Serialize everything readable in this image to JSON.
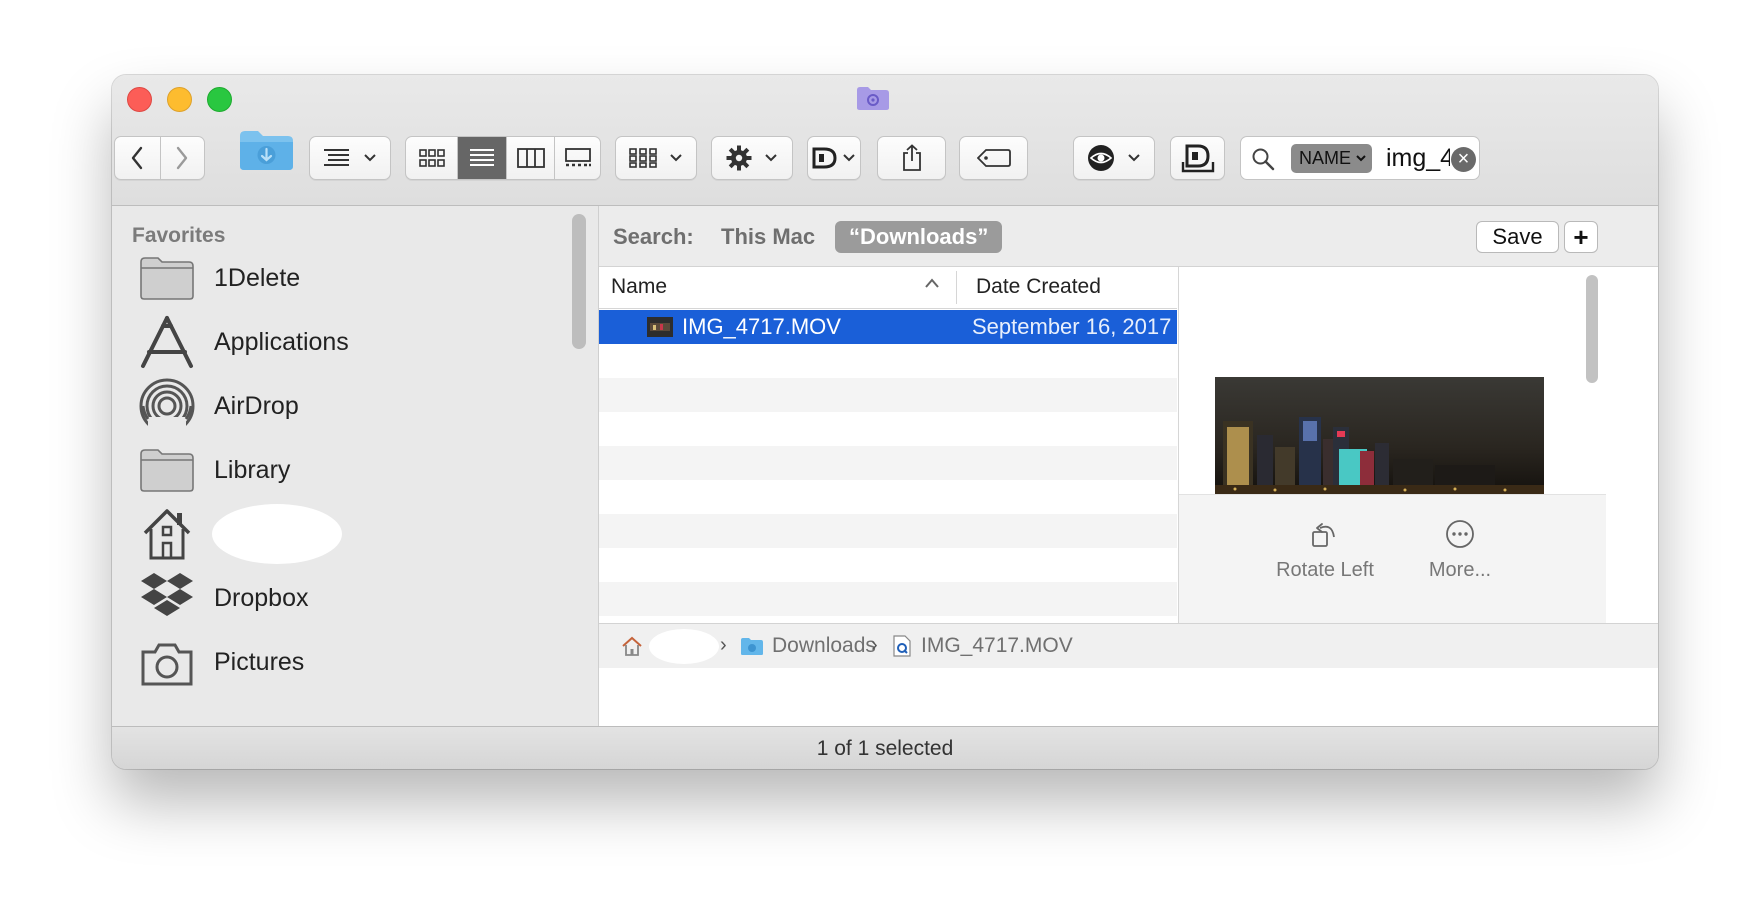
{
  "window": {
    "title_icon": "folder-gear-icon"
  },
  "toolbar": {
    "back_icon": "chevron-left-icon",
    "forward_icon": "chevron-right-icon",
    "location_icon": "downloads-folder-icon",
    "group_icon": "list-arrange-icon",
    "views": [
      "icon-view-icon",
      "list-view-icon",
      "column-view-icon",
      "gallery-view-icon"
    ],
    "active_view": "list",
    "search_name_token": "NAME",
    "search_text": "img_4"
  },
  "sidebar": {
    "heading": "Favorites",
    "items": [
      {
        "label": "1Delete",
        "icon": "folder-icon"
      },
      {
        "label": "Applications",
        "icon": "applications-icon"
      },
      {
        "label": "AirDrop",
        "icon": "airdrop-icon"
      },
      {
        "label": "Library",
        "icon": "folder-icon"
      },
      {
        "label": "",
        "icon": "home-icon"
      },
      {
        "label": "Dropbox",
        "icon": "dropbox-icon"
      },
      {
        "label": "Pictures",
        "icon": "camera-icon"
      }
    ]
  },
  "search_scope": {
    "label": "Search:",
    "option_mac": "This Mac",
    "option_folder": "“Downloads”",
    "save_label": "Save",
    "add_label": "+"
  },
  "list": {
    "col_name": "Name",
    "col_date": "Date Created",
    "rows": [
      {
        "name": "IMG_4717.MOV",
        "date": "September 16, 2017"
      }
    ]
  },
  "preview": {
    "rotate_label": "Rotate Left",
    "more_label": "More..."
  },
  "pathbar": {
    "folder": "Downloads",
    "file": "IMG_4717.MOV"
  },
  "status": {
    "text": "1 of 1 selected"
  }
}
